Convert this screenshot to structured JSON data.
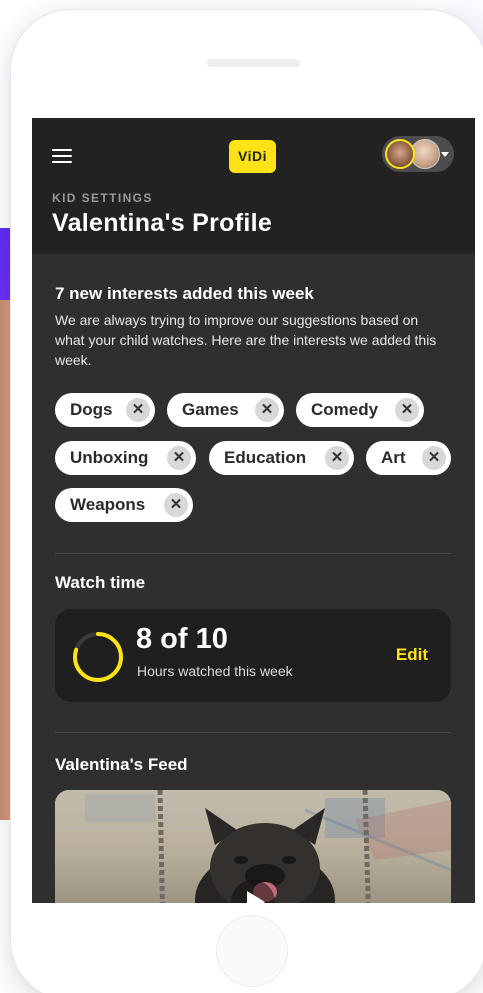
{
  "app": {
    "logo_text": "ViDi",
    "brand_color": "#ffe316",
    "screen_bg": "#2f2f2f"
  },
  "header": {
    "menu_icon": "hamburger-menu-icon",
    "section_label": "KID SETTINGS",
    "title": "Valentina's Profile",
    "account_switcher": {
      "avatar_count": 2,
      "caret_icon": "chevron-down-icon"
    }
  },
  "interests": {
    "heading": "7 new interests added this week",
    "description": "We are always trying to improve our suggestions based on what your child watches. Here are the interests we added this week.",
    "chips": [
      {
        "label": "Dogs",
        "remove_icon": "close-icon"
      },
      {
        "label": "Games",
        "remove_icon": "close-icon"
      },
      {
        "label": "Comedy",
        "remove_icon": "close-icon"
      },
      {
        "label": "Unboxing",
        "remove_icon": "close-icon"
      },
      {
        "label": "Education",
        "remove_icon": "close-icon"
      },
      {
        "label": "Art",
        "remove_icon": "close-icon"
      },
      {
        "label": "Weapons",
        "remove_icon": "close-icon"
      }
    ]
  },
  "watch_time": {
    "heading": "Watch time",
    "count_text": "8 of 10",
    "subtitle": "Hours watched this week",
    "edit_label": "Edit",
    "progress": 0.8
  },
  "feed": {
    "heading": "Valentina's Feed"
  }
}
